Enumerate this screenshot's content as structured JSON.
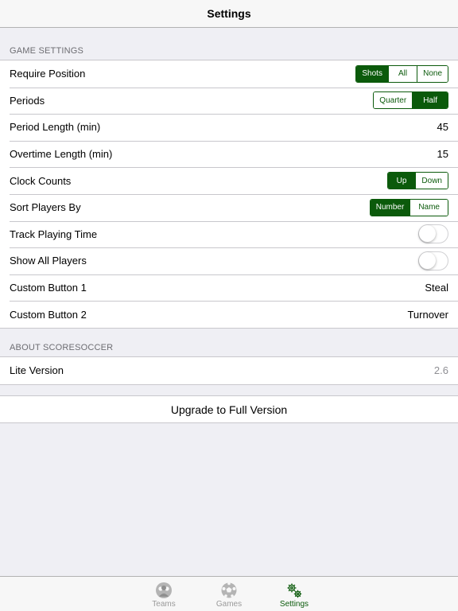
{
  "nav": {
    "title": "Settings"
  },
  "game_settings": {
    "header": "GAME SETTINGS",
    "require_position": {
      "label": "Require Position",
      "options": [
        "Shots",
        "All",
        "None"
      ],
      "selected": "Shots"
    },
    "periods": {
      "label": "Periods",
      "options": [
        "Quarter",
        "Half"
      ],
      "selected": "Half"
    },
    "period_length": {
      "label": "Period Length (min)",
      "value": "45"
    },
    "overtime_length": {
      "label": "Overtime Length (min)",
      "value": "15"
    },
    "clock_counts": {
      "label": "Clock Counts",
      "options": [
        "Up",
        "Down"
      ],
      "selected": "Up"
    },
    "sort_players": {
      "label": "Sort Players By",
      "options": [
        "Number",
        "Name"
      ],
      "selected": "Number"
    },
    "track_playing_time": {
      "label": "Track Playing Time",
      "on": false
    },
    "show_all_players": {
      "label": "Show All Players",
      "on": false
    },
    "custom_button_1": {
      "label": "Custom Button 1",
      "value": "Steal"
    },
    "custom_button_2": {
      "label": "Custom Button 2",
      "value": "Turnover"
    }
  },
  "about": {
    "header": "ABOUT SCORESOCCER",
    "lite_version": {
      "label": "Lite Version",
      "value": "2.6"
    }
  },
  "upgrade": {
    "label": "Upgrade to Full Version"
  },
  "tabbar": {
    "tabs": [
      {
        "label": "Teams",
        "icon": "teams-icon",
        "active": false
      },
      {
        "label": "Games",
        "icon": "soccer-ball-icon",
        "active": false
      },
      {
        "label": "Settings",
        "icon": "gears-icon",
        "active": true
      }
    ]
  },
  "colors": {
    "accent": "#0b5a0b",
    "background": "#efeff4",
    "inactive_tab": "#9a9a9a"
  }
}
